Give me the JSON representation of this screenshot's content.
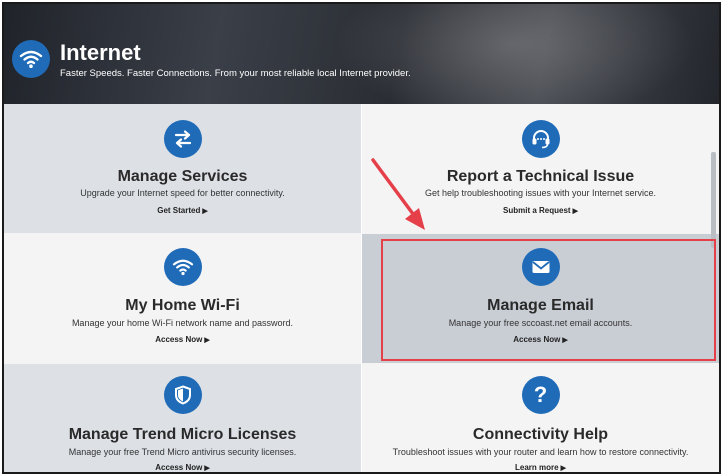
{
  "header": {
    "title": "Internet",
    "subtitle": "Faster Speeds. Faster Connections. From your most reliable local Internet provider.",
    "icon": "wifi-icon"
  },
  "tiles": [
    {
      "title": "Manage Services",
      "desc": "Upgrade your Internet speed for better connectivity.",
      "link": "Get Started",
      "icon": "arrows-exchange-icon"
    },
    {
      "title": "Report a Technical Issue",
      "desc": "Get help troubleshooting issues with your Internet service.",
      "link": "Submit a Request",
      "icon": "headset-icon"
    },
    {
      "title": "My Home Wi-Fi",
      "desc": "Manage your home Wi-Fi network name and password.",
      "link": "Access Now",
      "icon": "wifi-icon"
    },
    {
      "title": "Manage Email",
      "desc": "Manage your free sccoast.net email accounts.",
      "link": "Access Now",
      "icon": "envelope-icon"
    },
    {
      "title": "Manage Trend Micro Licenses",
      "desc": "Manage your free Trend Micro antivirus security licenses.",
      "link": "Access Now",
      "icon": "shield-icon"
    },
    {
      "title": "Connectivity Help",
      "desc": "Troubleshoot issues with your router and learn how to restore connectivity.",
      "link": "Learn more",
      "icon": "question-icon"
    }
  ],
  "colors": {
    "accent": "#1f6bb8",
    "highlight": "#e5404a"
  }
}
